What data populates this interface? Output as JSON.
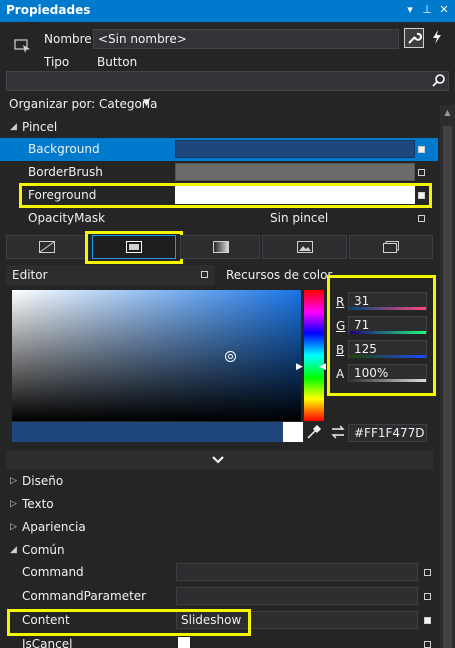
{
  "window": {
    "title": "Propiedades"
  },
  "header": {
    "name_label": "Nombre",
    "name_value": "<Sin nombre>",
    "type_label": "Tipo",
    "type_value": "Button"
  },
  "toolbar": {
    "arrange_label": "Organizar por: Categoría"
  },
  "brush_section": {
    "title": "Pincel",
    "properties": [
      {
        "name": "Background",
        "value": "",
        "swatch": "#1f477d"
      },
      {
        "name": "BorderBrush",
        "value": "",
        "swatch": "#6b6b6b"
      },
      {
        "name": "Foreground",
        "value": "",
        "swatch": "#ffffff"
      },
      {
        "name": "OpacityMask",
        "value": "Sin pincel",
        "swatch": ""
      }
    ],
    "editor_label": "Editor",
    "resources_label": "Recursos de color"
  },
  "color": {
    "r_label": "R",
    "r_value": "31",
    "g_label": "G",
    "g_value": "71",
    "b_label": "B",
    "b_value": "125",
    "a_label": "A",
    "a_value": "100%",
    "hex_value": "#FF1F477D",
    "accent": "#1f477d"
  },
  "sections": [
    {
      "title": "Diseño",
      "expanded": false
    },
    {
      "title": "Texto",
      "expanded": false
    },
    {
      "title": "Apariencia",
      "expanded": false
    },
    {
      "title": "Común",
      "expanded": true
    }
  ],
  "common": {
    "properties": [
      {
        "name": "Command",
        "value": ""
      },
      {
        "name": "CommandParameter",
        "value": ""
      },
      {
        "name": "Content",
        "value": "Slideshow"
      },
      {
        "name": "IsCancel",
        "value": ""
      }
    ]
  },
  "colors": {
    "selection": "#007acc",
    "highlight": "#f5f500",
    "panel": "#252526"
  }
}
